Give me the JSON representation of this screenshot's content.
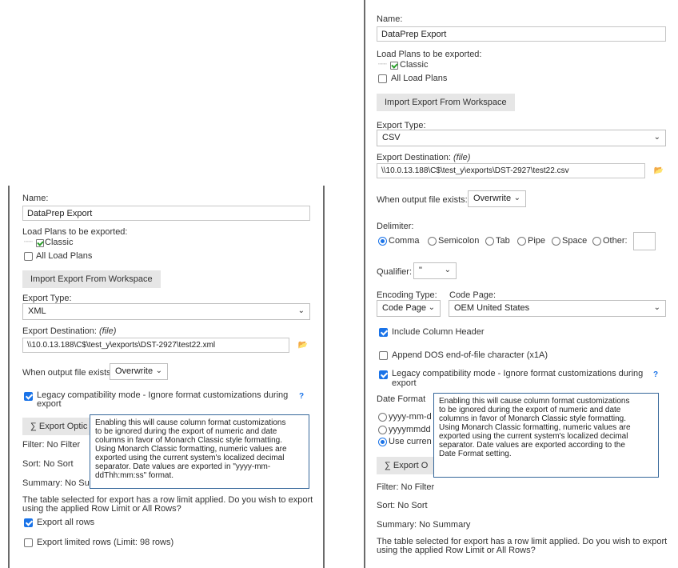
{
  "left": {
    "name_label": "Name:",
    "name_value": "DataPrep Export",
    "load_plans_label": "Load Plans to be exported:",
    "tree_item": "Classic",
    "all_plans": "All Load Plans",
    "import_button": "Import Export From Workspace",
    "export_type_label": "Export Type:",
    "export_type_value": "XML",
    "dest_label": "Export Destination:",
    "dest_file": "(file)",
    "dest_value": "\\\\10.0.13.188\\C$\\test_y\\exports\\DST-2927\\test22.xml",
    "when_exists_label": "When output file exists:",
    "when_exists_value": "Overwrite",
    "legacy_label_1": "Legacy compatibility mode - Ignore format customizations during",
    "legacy_label_2": "export",
    "help": "?",
    "export_options_button": "∑ Export Optic",
    "filter": "Filter: No Filter",
    "sort": "Sort: No Sort",
    "summary": "Summary: No Su",
    "row_limit_1": "The table selected for export has a row limit applied. Do you wish to export",
    "row_limit_2": "using the applied Row Limit or All Rows?",
    "export_all": "Export all rows",
    "export_limited": "Export limited rows (Limit: 98 rows)",
    "tooltip": "Enabling this will cause column format customizations\nto be ignored during the export of numeric and date\ncolumns in favor of Monarch Classic style formatting.\nUsing Monarch Classic formatting, numeric values are\nexported using the current system's localized decimal\nseparator. Date values are exported in \"yyyy-mm-\nddThh:mm:ss\" format."
  },
  "right": {
    "name_label": "Name:",
    "name_value": "DataPrep Export",
    "load_plans_label": "Load Plans to be exported:",
    "tree_item": "Classic",
    "all_plans": "All Load Plans",
    "import_button": "Import Export From Workspace",
    "export_type_label": "Export Type:",
    "export_type_value": "CSV",
    "dest_label": "Export Destination:",
    "dest_file": "(file)",
    "dest_value": "\\\\10.0.13.188\\C$\\test_y\\exports\\DST-2927\\test22.csv",
    "when_exists_label": "When output file exists:",
    "when_exists_value": "Overwrite",
    "delimiter_label": "Delimiter:",
    "delimiters": [
      "Comma",
      "Semicolon",
      "Tab",
      "Pipe",
      "Space",
      "Other:"
    ],
    "qualifier_label": "Qualifier:",
    "qualifier_value": "\"",
    "encoding_label": "Encoding Type:",
    "encoding_value": "Code Page",
    "code_page_label": "Code Page:",
    "code_page_value": "OEM United States",
    "include_header": "Include Column Header",
    "append_dos": "Append DOS end-of-file character (x1A)",
    "legacy_label_1": "Legacy compatibility mode - Ignore format customizations during",
    "legacy_label_2": "export",
    "help": "?",
    "date_format_label": "Date Format",
    "date_opt_1": "yyyy-mm-d",
    "date_opt_2": "yyyymmdd",
    "date_opt_3": "Use curren",
    "export_options_button": "∑ Export O",
    "filter": "Filter: No Filter",
    "sort": "Sort: No Sort",
    "summary": "Summary: No Summary",
    "row_limit_1": "The table selected for export has a row limit applied. Do you wish to export",
    "row_limit_2": "using the applied Row Limit or All Rows?",
    "tooltip": "Enabling this will cause column format customizations\nto be ignored during the export of numeric and date\ncolumns in favor of Monarch Classic style formatting.\nUsing Monarch Classic formatting, numeric values are\nexported using the current system's localized decimal\nseparator. Date values are exported according to the\nDate Format setting."
  }
}
